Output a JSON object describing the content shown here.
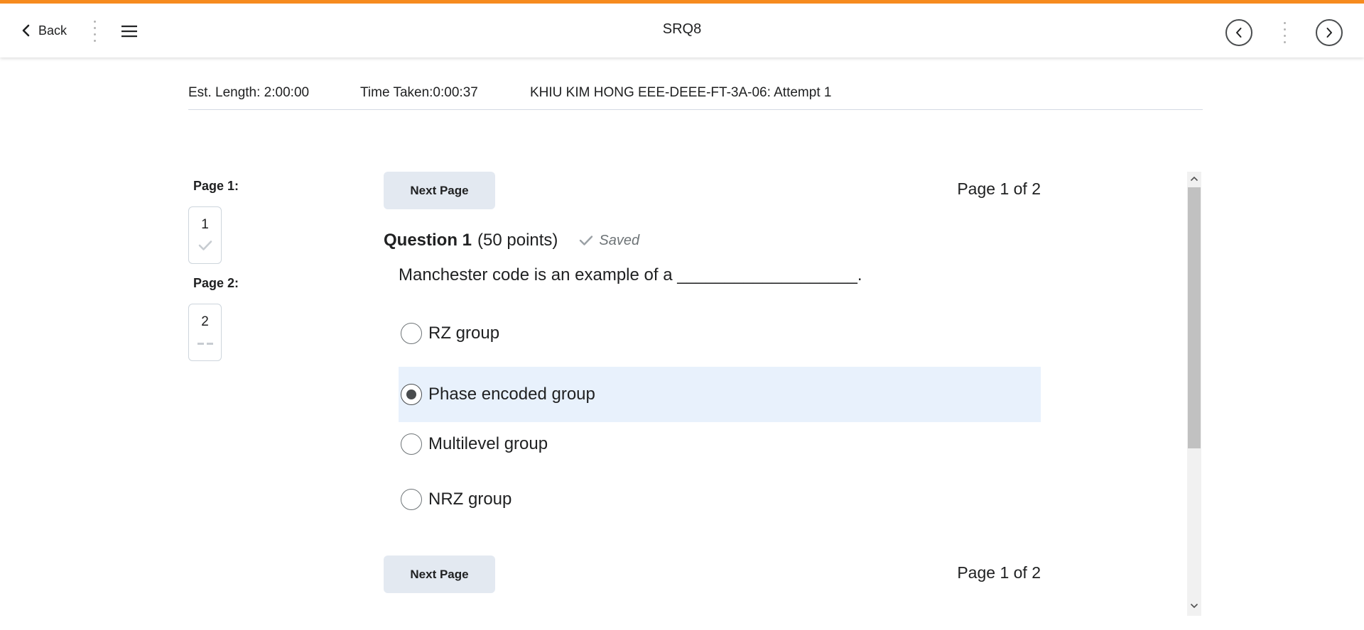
{
  "header": {
    "back_label": "Back",
    "title": "SRQ8",
    "accent_color": "#f68b1f"
  },
  "info": {
    "est_length": "Est. Length: 2:00:00",
    "time_taken": "Time Taken:0:00:37",
    "attempt": "KHIU KIM HONG EEE-DEEE-FT-3A-06: Attempt 1"
  },
  "sidebar": {
    "pages": [
      {
        "label": "Page 1:",
        "question_number": "1",
        "status_icon": "check-icon",
        "status": "answered"
      },
      {
        "label": "Page 2:",
        "question_number": "2",
        "status_icon": "dash-icon",
        "status": "unanswered"
      }
    ]
  },
  "nav": {
    "next_page_label": "Next Page",
    "page_indicator": "Page 1 of 2"
  },
  "question": {
    "title": "Question 1",
    "points": "(50 points)",
    "saved_label": "Saved",
    "text": "Manchester code is an example of a ___________________.",
    "options": [
      {
        "label": "RZ group",
        "selected": false
      },
      {
        "label": "Phase encoded group",
        "selected": true
      },
      {
        "label": "Multilevel group",
        "selected": false
      },
      {
        "label": "NRZ group",
        "selected": false
      }
    ],
    "selected_color": "#e8f1fc"
  }
}
